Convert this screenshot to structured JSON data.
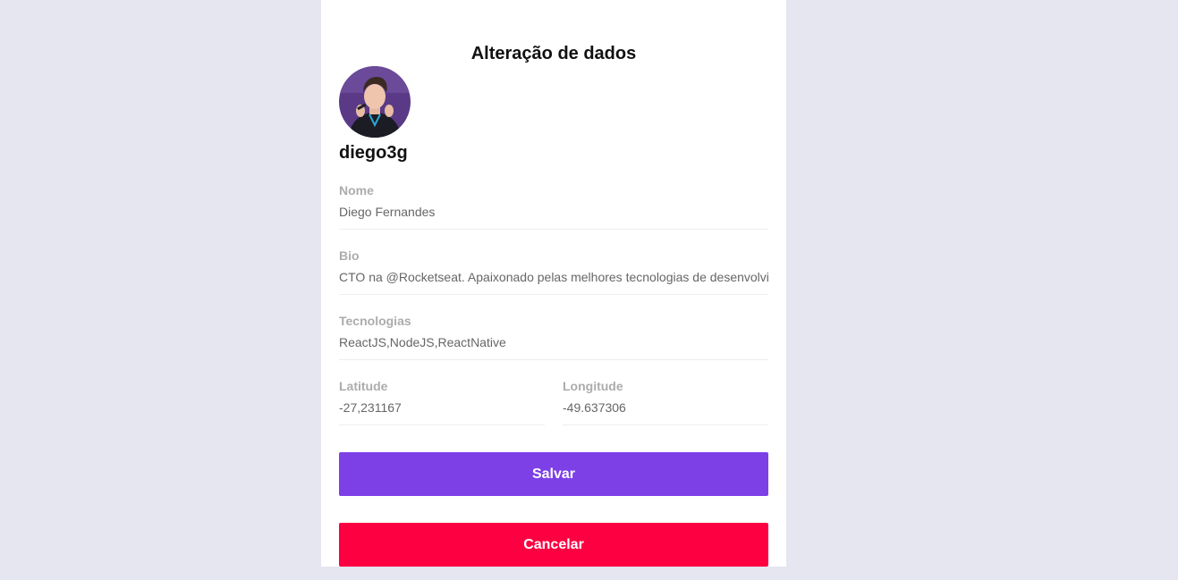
{
  "page": {
    "title": "Alteração de dados"
  },
  "profile": {
    "username": "diego3g",
    "avatar_icon": "user-avatar-photo"
  },
  "form": {
    "nome": {
      "label": "Nome",
      "value": "Diego Fernandes"
    },
    "bio": {
      "label": "Bio",
      "value": "CTO na @Rocketseat. Apaixonado pelas melhores tecnologias de desenvolvimento web e mobile."
    },
    "tecnologias": {
      "label": "Tecnologias",
      "value": "ReactJS,NodeJS,ReactNative"
    },
    "latitude": {
      "label": "Latitude",
      "value": "-27,231167"
    },
    "longitude": {
      "label": "Longitude",
      "value": "-49.637306"
    }
  },
  "actions": {
    "save_label": "Salvar",
    "cancel_label": "Cancelar"
  },
  "colors": {
    "background": "#e5e6f0",
    "card": "#ffffff",
    "primary": "#7d40e7",
    "danger": "#fc0042",
    "label": "#acacac",
    "input_text": "#666666"
  }
}
